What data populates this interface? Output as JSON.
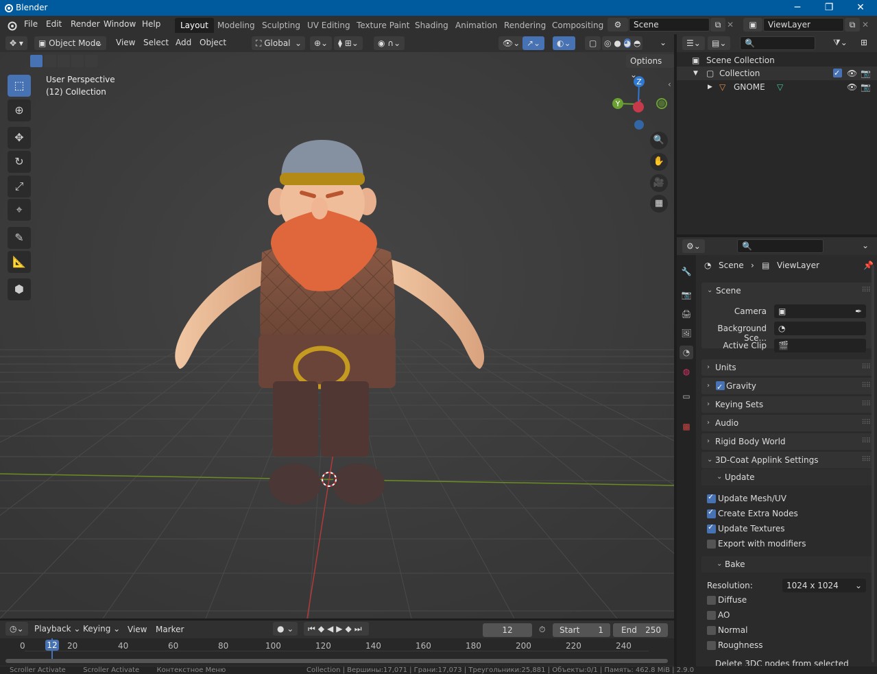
{
  "app_title": "Blender",
  "window_buttons": [
    "─",
    "❐",
    "✕"
  ],
  "menu": [
    "File",
    "Edit",
    "Render",
    "Window",
    "Help"
  ],
  "workspaces": [
    "Layout",
    "Modeling",
    "Sculpting",
    "UV Editing",
    "Texture Paint",
    "Shading",
    "Animation",
    "Rendering",
    "Compositing"
  ],
  "scene_field": "Scene",
  "viewlayer_field": "ViewLayer",
  "viewport_header": {
    "mode": "Object Mode",
    "menus": [
      "View",
      "Select",
      "Add",
      "Object"
    ],
    "transform_orientation": "Global",
    "options_label": "Options"
  },
  "viewport": {
    "perspective_label": "User Perspective",
    "collection_label": "(12) Collection",
    "gizmo_axes": {
      "z": "Z",
      "y": "Y"
    }
  },
  "outliner": {
    "scene_collection": "Scene Collection",
    "collection": "Collection",
    "object": "GNOME"
  },
  "properties": {
    "breadcrumb_scene": "Scene",
    "breadcrumb_viewlayer": "ViewLayer",
    "scene_panel": "Scene",
    "camera_label": "Camera",
    "background_label": "Background Sce...",
    "active_clip_label": "Active Clip",
    "panels": [
      "Units",
      "Gravity",
      "Keying Sets",
      "Audio",
      "Rigid Body World"
    ],
    "gravity_checked": true,
    "applink_panel": "3D-Coat Applink Settings",
    "update_subpanel": "Update",
    "update_options": [
      {
        "label": "Update Mesh/UV",
        "checked": true
      },
      {
        "label": "Create Extra Nodes",
        "checked": true
      },
      {
        "label": "Update Textures",
        "checked": true
      },
      {
        "label": "Export with modifiers",
        "checked": false
      }
    ],
    "bake_subpanel": "Bake",
    "resolution_label": "Resolution:",
    "resolution_value": "1024 x 1024",
    "bake_options": [
      {
        "label": "Diffuse",
        "checked": false
      },
      {
        "label": "AO",
        "checked": false
      },
      {
        "label": "Normal",
        "checked": false
      },
      {
        "label": "Roughness",
        "checked": false
      }
    ],
    "cut_off_label": "Delete 3DC nodes from selected"
  },
  "timeline": {
    "menus": [
      "Playback",
      "Keying",
      "View",
      "Marker"
    ],
    "current_frame": "12",
    "start_label": "Start",
    "start_value": "1",
    "end_label": "End",
    "end_value": "250",
    "ruler": [
      "0",
      "20",
      "40",
      "60",
      "80",
      "100",
      "120",
      "140",
      "160",
      "180",
      "200",
      "220",
      "240"
    ]
  },
  "status_bar": "Scroller Activate        Scroller Activate        Контекстное Меню                                     Collection | Вершины:17,071 | Грани:17,073 | Треугольники:25,881 | Объекты:0/1 | Память: 462.8 MiB | 2.9.0"
}
